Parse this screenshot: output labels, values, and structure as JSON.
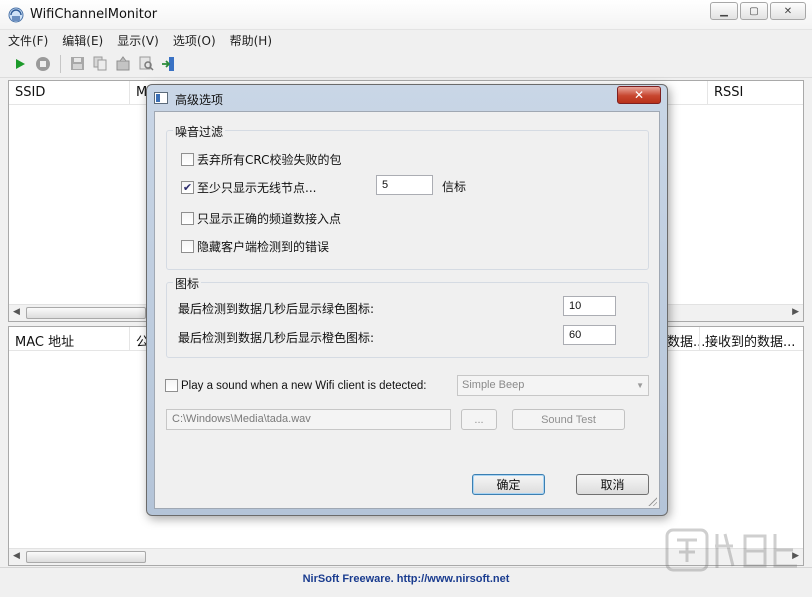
{
  "window": {
    "title": "WifiChannelMonitor"
  },
  "menu": [
    "文件(F)",
    "编辑(E)",
    "显示(V)",
    "选项(O)",
    "帮助(H)"
  ],
  "top_table": {
    "columns": [
      "SSID",
      "M",
      "RSSI"
    ]
  },
  "bottom_table": {
    "columns": [
      "MAC 地址",
      "公",
      "数据...",
      "接收到的数据..."
    ]
  },
  "statusbar": {
    "text": "NirSoft Freeware.  http://www.nirsoft.net"
  },
  "dialog": {
    "title": "高级选项",
    "close_glyph": "✕",
    "noise_group": {
      "title": "噪音过滤",
      "discard_crc": {
        "label": "丢弃所有CRC校验失败的包",
        "checked": false
      },
      "min_nodes": {
        "label": "至少只显示无线节点...",
        "checked": true,
        "value": "5",
        "unit": "信标"
      },
      "only_valid_channel": {
        "label": "只显示正确的频道数接入点",
        "checked": false
      },
      "hide_client_errors": {
        "label": "隐藏客户端检测到的错误",
        "checked": false
      }
    },
    "icon_group": {
      "title": "图标",
      "green_label": "最后检测到数据几秒后显示绿色图标:",
      "green_value": "10",
      "orange_label": "最后检测到数据几秒后显示橙色图标:",
      "orange_value": "60"
    },
    "sound": {
      "label": "Play a sound when a new Wifi client is detected:",
      "checked": false,
      "selected": "Simple Beep",
      "file": "C:\\Windows\\Media\\tada.wav",
      "browse_label": "...",
      "test_label": "Sound Test"
    },
    "ok_label": "确定",
    "cancel_label": "取消"
  }
}
